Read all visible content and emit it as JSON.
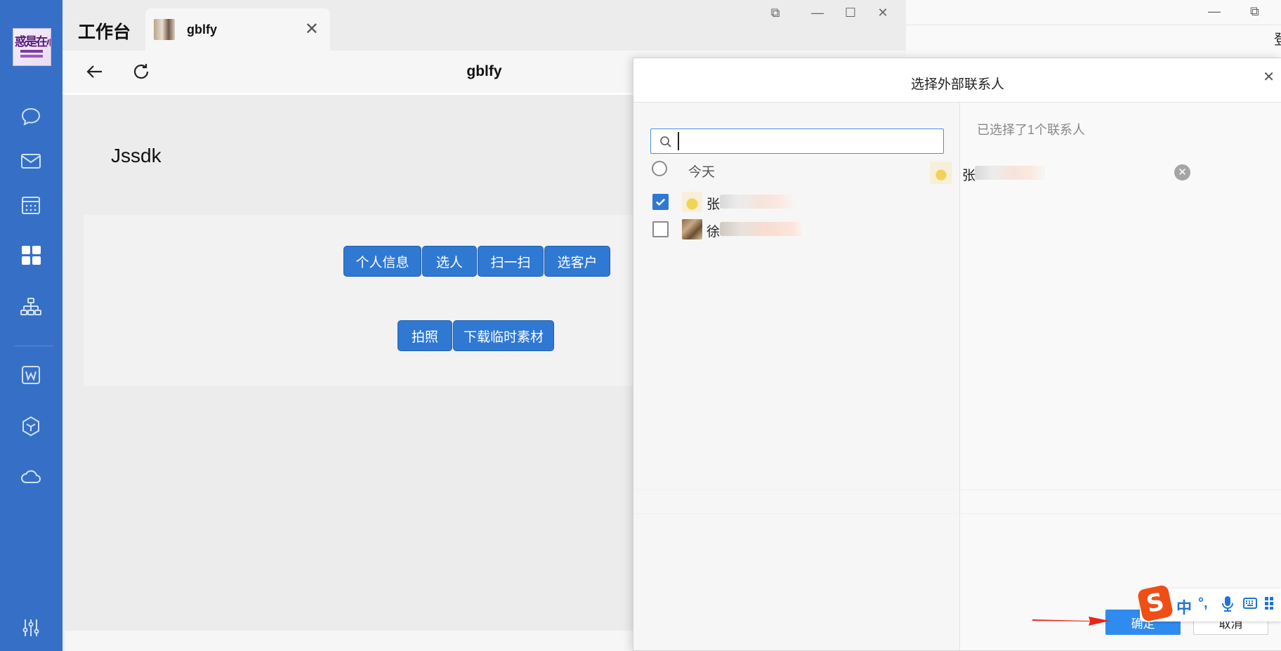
{
  "sidebar": {
    "logo_text": "惑是在心",
    "items": [
      {
        "icon": "chat-bubble-icon"
      },
      {
        "icon": "mail-icon"
      },
      {
        "icon": "calendar-icon"
      },
      {
        "icon": "workbench-grid-icon"
      },
      {
        "icon": "org-chart-icon"
      },
      {
        "icon": "document-w-icon"
      },
      {
        "icon": "cube-icon"
      },
      {
        "icon": "cloud-icon"
      },
      {
        "icon": "settings-sliders-icon"
      }
    ]
  },
  "window": {
    "app_title": "工作台",
    "tab_label": "gblfy",
    "page_title": "gblfy"
  },
  "content": {
    "heading": "Jssdk",
    "buttons_row1": [
      "个人信息",
      "选人",
      "扫一扫",
      "选客户"
    ],
    "buttons_row2": [
      "拍照",
      "下载临时素材"
    ]
  },
  "background_window": {
    "partial_char": "登"
  },
  "dialog": {
    "title": "选择外部联系人",
    "search": {
      "value": "",
      "placeholder": ""
    },
    "group_label": "今天",
    "contacts": [
      {
        "name": "张",
        "checked": true,
        "avatar": "pikachu"
      },
      {
        "name": "徐",
        "checked": false,
        "avatar": "photo"
      }
    ],
    "selected_count_text": "已选择了1个联系人",
    "selected": [
      {
        "name": "张"
      }
    ],
    "confirm_label": "确定",
    "cancel_label": "取消"
  },
  "ime_toolbar": {
    "logo": "S",
    "mode": "中",
    "punct": "°,",
    "icons": [
      "microphone-icon",
      "keyboard-icon",
      "grid-icon"
    ]
  },
  "colors": {
    "sidebar": "#3670c6",
    "primary_button": "#2f79d3",
    "confirm_button": "#2f8bee",
    "annotation_arrow": "#e8261a",
    "ime_brand": "#ef4f14"
  }
}
